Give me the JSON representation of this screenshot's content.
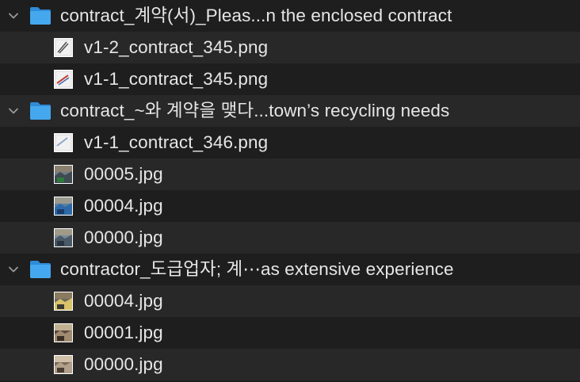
{
  "folders": [
    {
      "name": "contract_계약(서)_Pleas...n the enclosed contract",
      "icon": "folder-icon",
      "expanded": true,
      "files": [
        {
          "name": "v1-2_contract_345.png",
          "thumb": "document-thumbnail-icon"
        },
        {
          "name": "v1-1_contract_345.png",
          "thumb": "document-thumbnail-icon"
        }
      ]
    },
    {
      "name": "contract_~와 계약을 맺다...town’s recycling needs",
      "icon": "folder-icon",
      "expanded": true,
      "files": [
        {
          "name": "v1-1_contract_346.png",
          "thumb": "document-thumbnail-icon"
        },
        {
          "name": "00005.jpg",
          "thumb": "photo-thumbnail-icon"
        },
        {
          "name": "00004.jpg",
          "thumb": "photo-thumbnail-icon"
        },
        {
          "name": "00000.jpg",
          "thumb": "photo-thumbnail-icon"
        }
      ]
    },
    {
      "name": "contractor_도급업자; 계⋯as extensive experience",
      "icon": "folder-icon",
      "expanded": true,
      "files": [
        {
          "name": "00004.jpg",
          "thumb": "photo-thumbnail-icon"
        },
        {
          "name": "00001.jpg",
          "thumb": "photo-thumbnail-icon"
        },
        {
          "name": "00000.jpg",
          "thumb": "photo-thumbnail-icon"
        }
      ]
    }
  ],
  "colors": {
    "row_odd": "#1e1e1e",
    "row_even": "#282828",
    "folder_blue": "#3a9ee8",
    "text": "#e6e6e6",
    "chevron": "#9a9a9a"
  }
}
